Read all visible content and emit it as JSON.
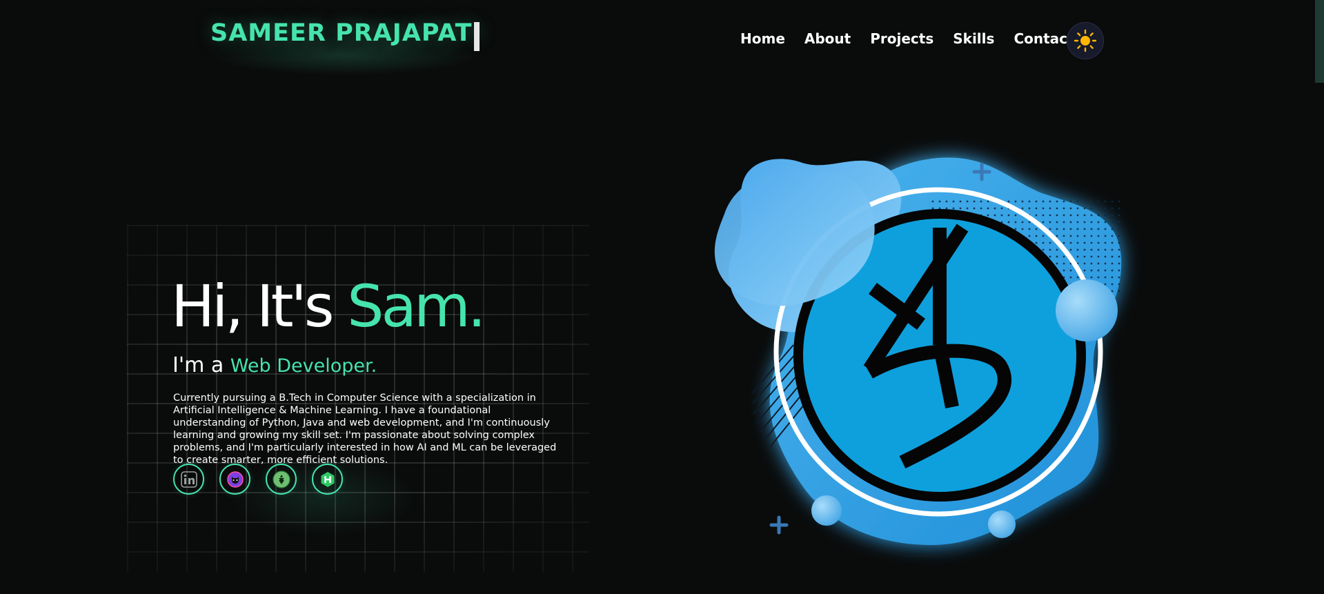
{
  "header": {
    "logo_text": "SAMEER PRAJAPATI",
    "nav": [
      {
        "label": "Home"
      },
      {
        "label": "About"
      },
      {
        "label": "Projects"
      },
      {
        "label": "Skills"
      },
      {
        "label": "Contact"
      }
    ],
    "theme_toggle_icon": "sun-icon"
  },
  "hero": {
    "greeting_prefix": "Hi, It's ",
    "greeting_name": "Sam.",
    "sub_prefix": "I'm a ",
    "sub_role": "Web Developer.",
    "description": "Currently pursuing a B.Tech in Computer Science with a specialization in Artificial Intelligence & Machine Learning. I have a foundational understanding of Python, Java and web development, and I'm continuously learning and growing my skill set. I'm passionate about solving complex problems, and I'm particularly interested in how AI and ML can be leveraged to create smarter, more efficient solutions.",
    "socials": [
      {
        "icon": "linkedin-icon"
      },
      {
        "icon": "github-icon"
      },
      {
        "icon": "leetcode-icon"
      },
      {
        "icon": "hackerrank-icon"
      }
    ]
  },
  "colors": {
    "accent": "#46e4ad",
    "background": "#0a0b0b",
    "blob_blue": "#2e9be0",
    "logo_circle": "#0ea0dd"
  }
}
